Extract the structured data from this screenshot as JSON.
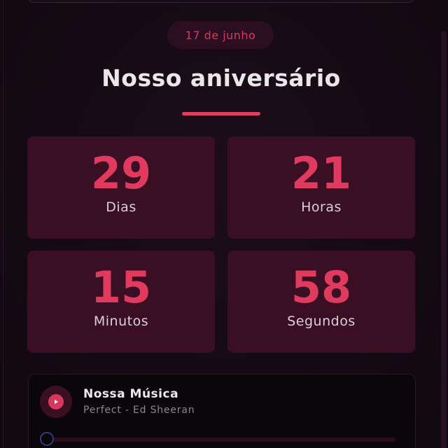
{
  "date_badge": "17 de junho",
  "title": "Nosso aniversário",
  "countdown": [
    {
      "value": "29",
      "label": "Dias"
    },
    {
      "value": "21",
      "label": "Horas"
    },
    {
      "value": "15",
      "label": "Minutos"
    },
    {
      "value": "58",
      "label": "Segundos"
    }
  ],
  "music": {
    "title": "Nossa Música",
    "subtitle": "Perfect - Ed Sheeran",
    "progress": 0,
    "play_icon": "play-icon"
  },
  "colors": {
    "accent": "#e03a5e",
    "tile_bg": "#3a0f23",
    "background": "#140a12"
  }
}
